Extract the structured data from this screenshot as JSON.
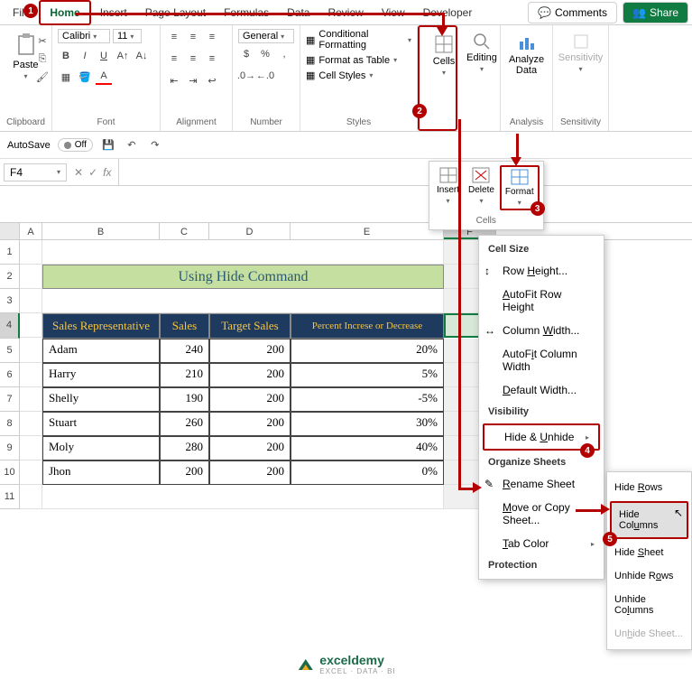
{
  "tabs": [
    "File",
    "Home",
    "Insert",
    "Page Layout",
    "Formulas",
    "Data",
    "Review",
    "View",
    "Developer"
  ],
  "active_tab": 1,
  "right_buttons": {
    "comments": "Comments",
    "share": "Share"
  },
  "ribbon": {
    "clipboard": {
      "label": "Clipboard",
      "paste": "Paste"
    },
    "font": {
      "label": "Font",
      "name": "Calibri",
      "size": "11"
    },
    "alignment": {
      "label": "Alignment"
    },
    "number": {
      "label": "Number",
      "format": "General"
    },
    "styles": {
      "label": "Styles",
      "cond": "Conditional Formatting",
      "table": "Format as Table",
      "cellstyles": "Cell Styles"
    },
    "cells": {
      "label": "Cells",
      "btn": "Cells"
    },
    "editing": {
      "label": "Editing",
      "btn": "Editing"
    },
    "analysis": {
      "label": "Analysis",
      "btn": "Analyze Data"
    },
    "sensitivity": {
      "label": "Sensitivity",
      "btn": "Sensitivity"
    }
  },
  "qat": {
    "autosave": "AutoSave",
    "state": "Off"
  },
  "namebox": "F4",
  "cells_popup": {
    "insert": "Insert",
    "delete": "Delete",
    "format": "Format",
    "group": "Cells"
  },
  "columns": {
    "A": 25,
    "B": 130,
    "C": 55,
    "D": 90,
    "E": 170,
    "F": 58
  },
  "row_headers": [
    "1",
    "2",
    "3",
    "4",
    "5",
    "6",
    "7",
    "8",
    "9",
    "10",
    "11"
  ],
  "title": "Using Hide Command",
  "table": {
    "headers": [
      "Sales Representative",
      "Sales",
      "Target Sales",
      "Percent Increse or Decrease"
    ],
    "rows": [
      [
        "Adam",
        "240",
        "200",
        "20%"
      ],
      [
        "Harry",
        "210",
        "200",
        "5%"
      ],
      [
        "Shelly",
        "190",
        "200",
        "-5%"
      ],
      [
        "Stuart",
        "260",
        "200",
        "30%"
      ],
      [
        "Moly",
        "280",
        "200",
        "40%"
      ],
      [
        "Jhon",
        "200",
        "200",
        "0%"
      ]
    ]
  },
  "format_menu": {
    "cell_size": "Cell Size",
    "row_height": "Row Height...",
    "autofit_row": "AutoFit Row Height",
    "col_width": "Column Width...",
    "autofit_col": "AutoFit Column Width",
    "default_width": "Default Width...",
    "visibility": "Visibility",
    "hide_unhide": "Hide & Unhide",
    "organize": "Organize Sheets",
    "rename": "Rename Sheet",
    "move_copy": "Move or Copy Sheet...",
    "tab_color": "Tab Color",
    "protection": "Protection"
  },
  "submenu": {
    "hide_rows": "Hide Rows",
    "hide_cols": "Hide Columns",
    "hide_sheet": "Hide Sheet",
    "unhide_rows": "Unhide Rows",
    "unhide_cols": "Unhide Columns",
    "unhide_sheet": "Unhide Sheet..."
  },
  "watermark": {
    "brand": "exceldemy",
    "tag": "EXCEL · DATA · BI"
  },
  "badges": {
    "b1": "1",
    "b2": "2",
    "b3": "3",
    "b4": "4",
    "b5": "5"
  }
}
